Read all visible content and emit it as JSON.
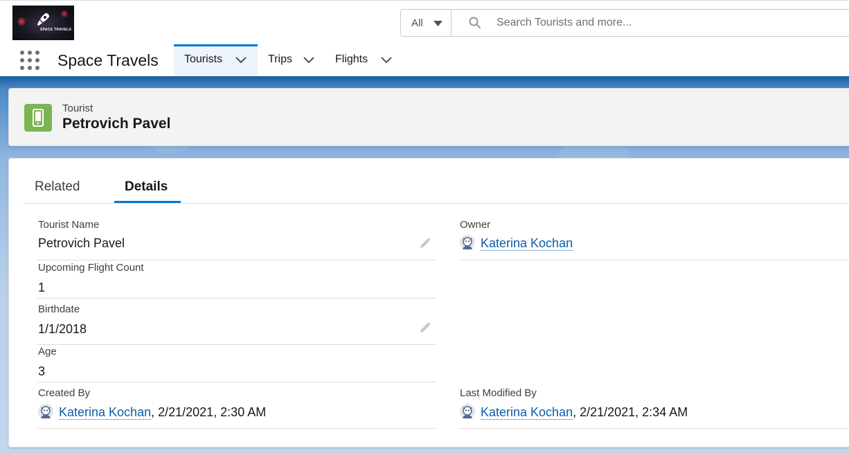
{
  "header": {
    "logo_text": "SPACE TRAVELS",
    "search_scope": "All",
    "search_placeholder": "Search Tourists and more..."
  },
  "nav": {
    "app_name": "Space Travels",
    "tabs": [
      {
        "label": "Tourists",
        "active": true
      },
      {
        "label": "Trips",
        "active": false
      },
      {
        "label": "Flights",
        "active": false
      }
    ]
  },
  "record": {
    "type": "Tourist",
    "name": "Petrovich Pavel",
    "icon": "mobile-phone-icon",
    "icon_color": "#7cb453"
  },
  "detail_tabs": {
    "related": "Related",
    "details": "Details",
    "active": "Details"
  },
  "fields": {
    "tourist_name": {
      "label": "Tourist Name",
      "value": "Petrovich Pavel"
    },
    "owner": {
      "label": "Owner",
      "value": "Katerina Kochan"
    },
    "upcoming_flight_count": {
      "label": "Upcoming Flight Count",
      "value": "1"
    },
    "birthdate": {
      "label": "Birthdate",
      "value": "1/1/2018"
    },
    "age": {
      "label": "Age",
      "value": "3"
    },
    "created_by": {
      "label": "Created By",
      "user": "Katerina Kochan",
      "date": ", 2/21/2021, 2:30 AM"
    },
    "last_modified_by": {
      "label": "Last Modified By",
      "user": "Katerina Kochan",
      "date": ", 2/21/2021, 2:34 AM"
    }
  },
  "colors": {
    "brand": "#0176d3",
    "link": "#0b5cab"
  }
}
